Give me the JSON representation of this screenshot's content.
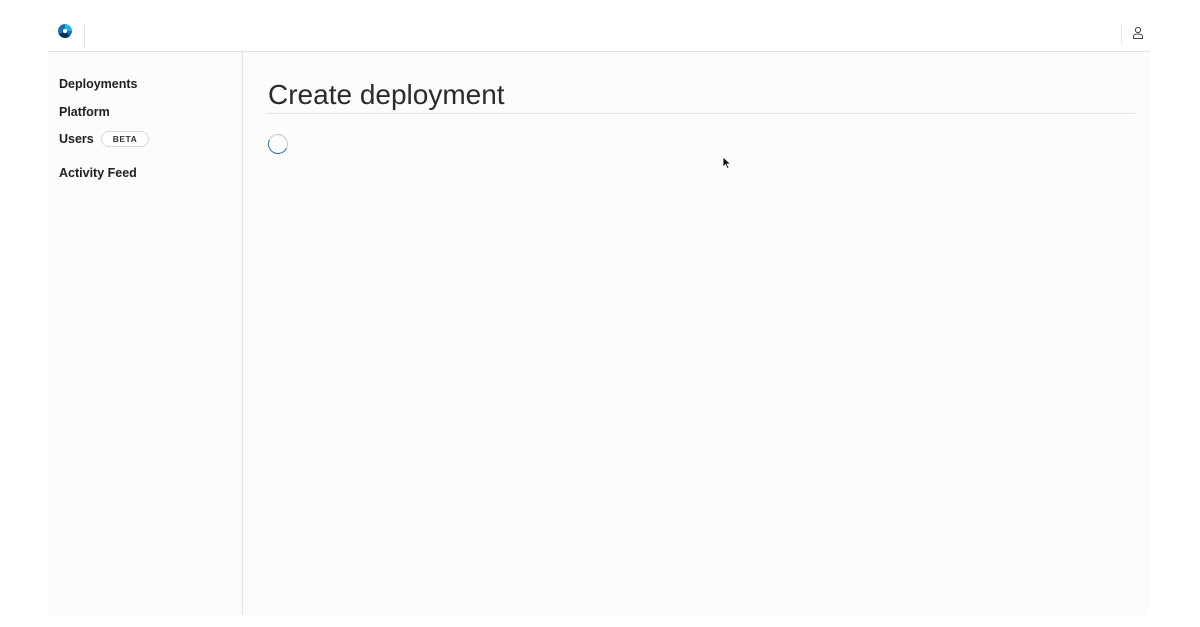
{
  "app": {
    "logo_icon": "brand-logo-icon",
    "brand_colors": {
      "primary": "#1a6fb5",
      "secondary": "#21b5e8"
    }
  },
  "header": {
    "user_icon": "user-icon"
  },
  "sidebar": {
    "items": [
      {
        "label": "Deployments"
      },
      {
        "label": "Platform"
      },
      {
        "label": "Users",
        "badge": "BETA"
      },
      {
        "label": "Activity Feed"
      }
    ]
  },
  "main": {
    "title": "Create deployment",
    "loading_icon": "loading-spinner-icon"
  }
}
